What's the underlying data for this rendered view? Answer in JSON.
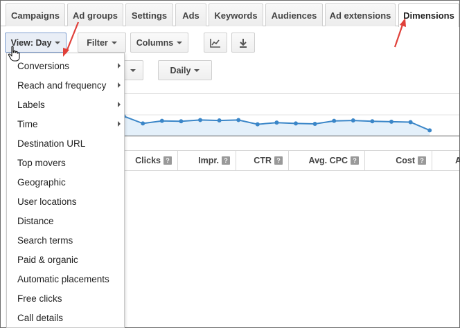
{
  "tabs": [
    {
      "label": "Campaigns"
    },
    {
      "label": "Ad groups"
    },
    {
      "label": "Settings"
    },
    {
      "label": "Ads"
    },
    {
      "label": "Keywords"
    },
    {
      "label": "Audiences"
    },
    {
      "label": "Ad extensions"
    },
    {
      "label": "Dimensions",
      "active": true
    }
  ],
  "toolbar": {
    "view_label": "View: Day",
    "filter_label": "Filter",
    "columns_label": "Columns",
    "chart_icon": "line-chart-icon",
    "download_icon": "download-icon",
    "daily_label": "Daily"
  },
  "view_menu": {
    "items": [
      {
        "label": "Conversions",
        "has_submenu": true
      },
      {
        "label": "Reach and frequency",
        "has_submenu": true
      },
      {
        "label": "Labels",
        "has_submenu": true
      },
      {
        "label": "Time",
        "has_submenu": true
      },
      {
        "label": "Destination URL"
      },
      {
        "label": "Top movers"
      },
      {
        "label": "Geographic"
      },
      {
        "label": "User locations"
      },
      {
        "label": "Distance"
      },
      {
        "label": "Search terms"
      },
      {
        "label": "Paid & organic"
      },
      {
        "label": "Automatic placements"
      },
      {
        "label": "Free clicks"
      },
      {
        "label": "Call details"
      }
    ]
  },
  "table": {
    "columns": [
      {
        "label": "Clicks"
      },
      {
        "label": "Impr."
      },
      {
        "label": "CTR"
      },
      {
        "label": "Avg. CPC"
      },
      {
        "label": "Cost"
      },
      {
        "label": "A"
      }
    ],
    "help_glyph": "?"
  },
  "colors": {
    "line": "#3a86c8",
    "fill": "#e4f0fa",
    "arrow": "#e0403a"
  },
  "chart_data": {
    "type": "area",
    "values": [
      0.62,
      0.47,
      0.3,
      0.36,
      0.35,
      0.38,
      0.37,
      0.38,
      0.28,
      0.32,
      0.3,
      0.29,
      0.36,
      0.37,
      0.35,
      0.34,
      0.33,
      0.14
    ],
    "ylim": [
      0,
      1
    ],
    "grid": true
  }
}
